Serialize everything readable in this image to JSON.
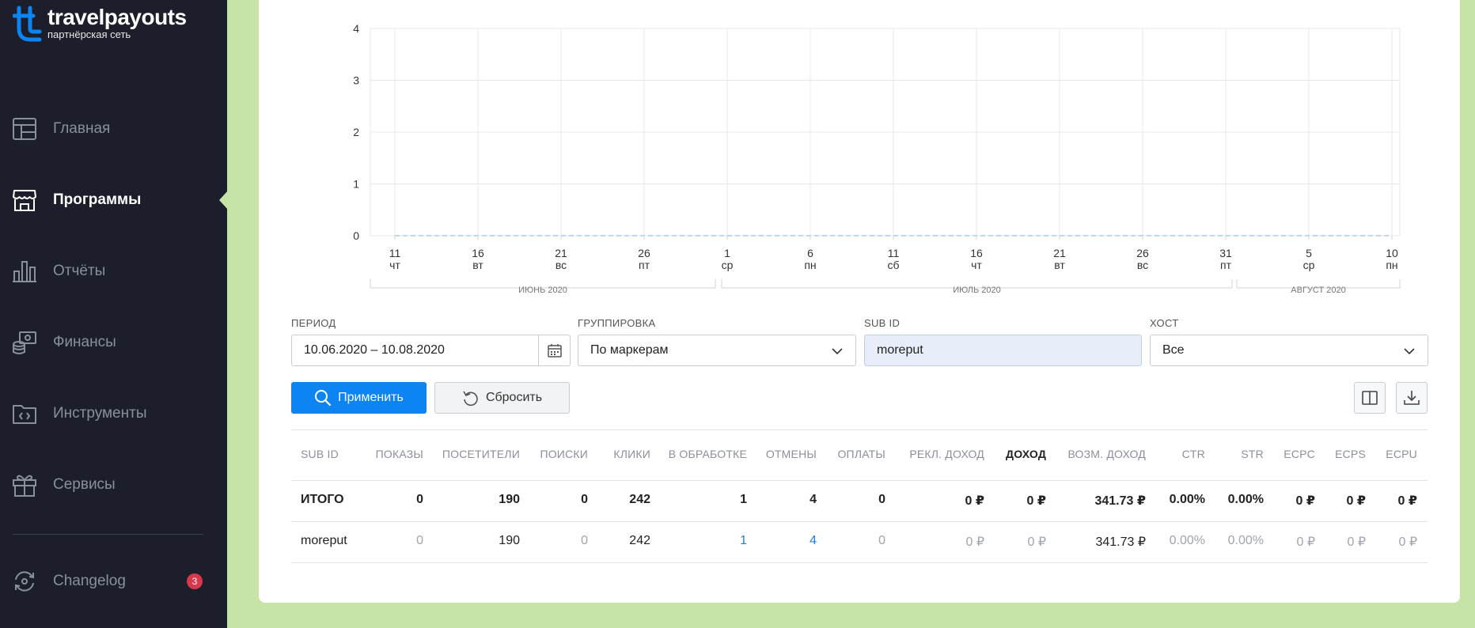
{
  "brand": {
    "name": "travelpayouts",
    "tagline": "партнёрская сеть",
    "color": "#0c85f3"
  },
  "sidebar": {
    "items": [
      {
        "label": "Главная",
        "icon": "dashboard-icon",
        "active": false
      },
      {
        "label": "Программы",
        "icon": "storefront-icon",
        "active": true
      },
      {
        "label": "Отчёты",
        "icon": "bar-chart-icon",
        "active": false
      },
      {
        "label": "Финансы",
        "icon": "finance-icon",
        "active": false
      },
      {
        "label": "Инструменты",
        "icon": "code-folder-icon",
        "active": false
      },
      {
        "label": "Сервисы",
        "icon": "gift-icon",
        "active": false
      }
    ],
    "changelog": {
      "label": "Changelog",
      "icon": "refresh-icon",
      "badge": "3"
    }
  },
  "chart_data": {
    "type": "line",
    "ylim": [
      0,
      4
    ],
    "yticks": [
      "0",
      "1",
      "2",
      "3",
      "4"
    ],
    "x_ticks": [
      {
        "day": "11",
        "weekday": "чт"
      },
      {
        "day": "16",
        "weekday": "вт"
      },
      {
        "day": "21",
        "weekday": "вс"
      },
      {
        "day": "26",
        "weekday": "пт"
      },
      {
        "day": "1",
        "weekday": "ср"
      },
      {
        "day": "6",
        "weekday": "пн"
      },
      {
        "day": "11",
        "weekday": "сб"
      },
      {
        "day": "16",
        "weekday": "чт"
      },
      {
        "day": "21",
        "weekday": "вт"
      },
      {
        "day": "26",
        "weekday": "вс"
      },
      {
        "day": "31",
        "weekday": "пт"
      },
      {
        "day": "5",
        "weekday": "ср"
      },
      {
        "day": "10",
        "weekday": "пн"
      }
    ],
    "months": [
      "ИЮНЬ 2020",
      "ИЮЛЬ 2020",
      "АВГУСТ 2020"
    ],
    "series": [
      {
        "values": [
          0,
          0,
          0,
          0,
          0,
          0,
          0,
          0,
          0,
          0,
          0,
          0,
          0
        ]
      }
    ],
    "grid": true
  },
  "filters": {
    "period": {
      "label": "ПЕРИОД",
      "value": "10.06.2020 – 10.08.2020"
    },
    "grouping": {
      "label": "ГРУППИРОВКА",
      "value": "По маркерам"
    },
    "subid": {
      "label": "SUB ID",
      "value": "moreput"
    },
    "host": {
      "label": "ХОСТ",
      "value": "Все"
    }
  },
  "actions": {
    "apply": "Применить",
    "reset": "Сбросить"
  },
  "table": {
    "columns": [
      "SUB ID",
      "ПОКАЗЫ",
      "ПОСЕТИТЕЛИ",
      "ПОИСКИ",
      "КЛИКИ",
      "В ОБРАБОТКЕ",
      "ОТМЕНЫ",
      "ОПЛАТЫ",
      "РЕКЛ. ДОХОД",
      "ДОХОД",
      "ВОЗМ. ДОХОД",
      "CTR",
      "STR",
      "ECPC",
      "ECPS",
      "ECPU"
    ],
    "total": [
      "ИТОГО",
      "0",
      "190",
      "0",
      "242",
      "1",
      "4",
      "0",
      "0 ₽",
      "0 ₽",
      "341.73 ₽",
      "0.00%",
      "0.00%",
      "0 ₽",
      "0 ₽",
      "0 ₽"
    ],
    "rows": [
      [
        "moreput",
        "0",
        "190",
        "0",
        "242",
        "1",
        "4",
        "0",
        "0 ₽",
        "0 ₽",
        "341.73 ₽",
        "0.00%",
        "0.00%",
        "0 ₽",
        "0 ₽",
        "0 ₽"
      ]
    ]
  }
}
